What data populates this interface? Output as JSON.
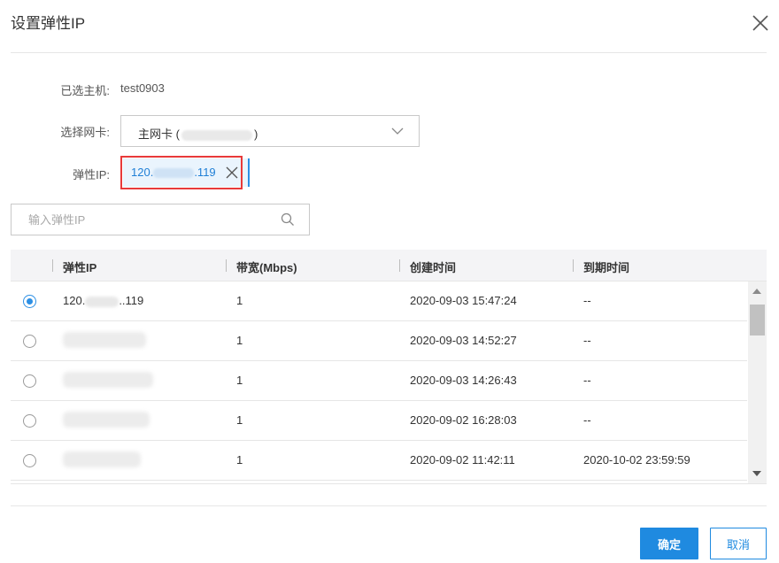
{
  "dialog": {
    "title": "设置弹性IP"
  },
  "form": {
    "host_label": "已选主机:",
    "host_value": "test0903",
    "nic_label": "选择网卡:",
    "nic_value_prefix": "主网卡 (",
    "nic_value_suffix": ")",
    "eip_label": "弹性IP:",
    "eip_selected_prefix": "120.",
    "eip_selected_suffix": ".119"
  },
  "search": {
    "placeholder": "输入弹性IP"
  },
  "table": {
    "headers": [
      "弹性IP",
      "带宽(Mbps)",
      "创建时间",
      "到期时间"
    ],
    "rows": [
      {
        "ip_prefix": "120.",
        "ip_suffix": "..119",
        "bandwidth": "1",
        "created": "2020-09-03 15:47:24",
        "expires": "--",
        "selected": true
      },
      {
        "bandwidth": "1",
        "created": "2020-09-03 14:52:27",
        "expires": "--",
        "selected": false
      },
      {
        "bandwidth": "1",
        "created": "2020-09-03 14:26:43",
        "expires": "--",
        "selected": false
      },
      {
        "bandwidth": "1",
        "created": "2020-09-02 16:28:03",
        "expires": "--",
        "selected": false
      },
      {
        "bandwidth": "1",
        "created": "2020-09-02 11:42:11",
        "expires": "2020-10-02 23:59:59",
        "selected": false
      }
    ]
  },
  "buttons": {
    "ok": "确定",
    "cancel": "取消"
  },
  "colors": {
    "accent": "#1f8ae0",
    "highlight": "#e83a3a"
  }
}
